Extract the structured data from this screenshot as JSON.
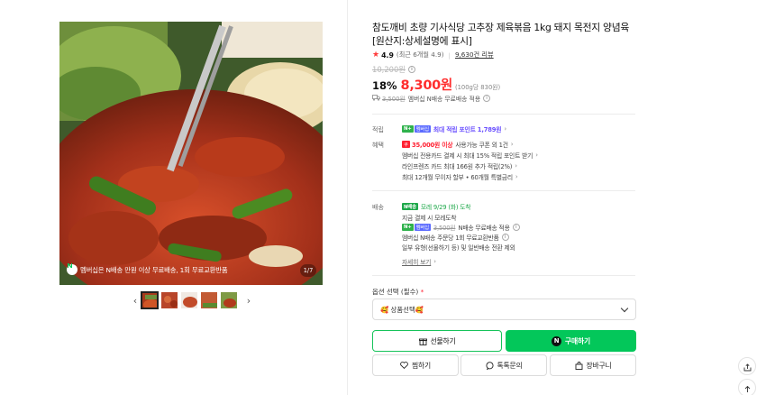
{
  "product": {
    "title": "참도깨비 초량 기사식당 고추장 제육볶음 1kg 돼지 목전지 양념육 [원산지:상세설명에 표시]",
    "rating": "4.9",
    "rating_note": "(최근 6개월 4.9)",
    "review_count": "9,630건 리뷰",
    "original_price": "10,200원",
    "discount": "18%",
    "sale_price": "8,300원",
    "unit_price": "(100g당 830원)",
    "shipping_label": "배",
    "shipping_original": "3,500원",
    "shipping_text": "멤버십 N배송 무료배송 적용"
  },
  "image": {
    "banner": "멤버십은 N배송 만원 이상 무료배송, 1회 무료교환반품",
    "counter": "1/7",
    "thumb_count": 5
  },
  "benefits": {
    "points_label": "적립",
    "points_text": "최대 적립 포인트 1,789원",
    "perks_label": "혜택",
    "coupon_amount": "35,000원 이상",
    "coupon_text": "사용가능 쿠폰 외 1건",
    "card_line": "멤버십 전용카드 결제 시 최대 15% 적립 포인트 받기",
    "line_friends": "라인프렌즈 카드 최대 166원 추가 적립(2%)",
    "installment": "최대 12개월 무이자 할부 • 60개월 특별금리",
    "badge_npay": "N+",
    "badge_member": "멤버십",
    "badge_red": "쿠"
  },
  "delivery": {
    "label": "배송",
    "arrival": "모레 9/29 (화) 도착",
    "condition": "지금 결제 시 모레도착",
    "free_ship_original": "3,500원",
    "free_ship_text": "N배송 무료배송 적용",
    "return_text": "멤버십 N배송 주문당 1회 무료교환반품",
    "exception": "일부 유형(선물하기 등) 및 일반배송 전환 제외",
    "more": "자세히 보기",
    "badge_n": "N배송"
  },
  "options": {
    "label": "옵션 선택",
    "required_mark": "(필수)",
    "required_star": "*",
    "selected": "🥰 상품선택🥰"
  },
  "actions": {
    "gift": "선물하기",
    "buy": "구매하기",
    "buy_n": "N",
    "wish": "찜하기",
    "talk": "톡톡문의",
    "cart": "장바구니"
  },
  "colors": {
    "accent_green": "#03c75a",
    "sale_red": "#ff2d2d",
    "purple": "#6a50ff"
  }
}
